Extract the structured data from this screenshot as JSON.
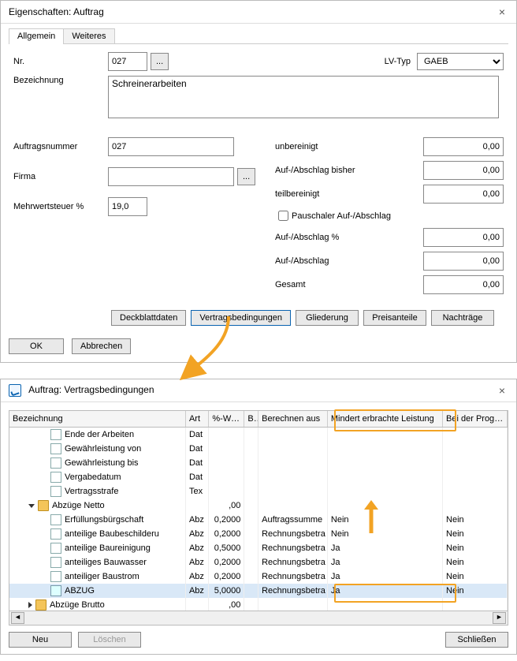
{
  "window1": {
    "title": "Eigenschaften: Auftrag",
    "tabs": {
      "active": "Allgemein",
      "other": "Weiteres"
    },
    "labels": {
      "nr": "Nr.",
      "lvtyp": "LV-Typ",
      "bezeichnung": "Bezeichnung",
      "auftragsnummer": "Auftragsnummer",
      "firma": "Firma",
      "mwst": "Mehrwertsteuer %",
      "unbereinigt": "unbereinigt",
      "aufab_bisher": "Auf-/Abschlag bisher",
      "teilbereinigt": "teilbereinigt",
      "pauschal": "Pauschaler Auf-/Abschlag",
      "aufab_pct": "Auf-/Abschlag %",
      "aufab": "Auf-/Abschlag",
      "gesamt": "Gesamt"
    },
    "values": {
      "nr": "027",
      "lvtyp": "GAEB",
      "bezeichnung": "Schreinerarbeiten",
      "auftragsnummer": "027",
      "firma": "",
      "mwst": "19,0",
      "unbereinigt": "0,00",
      "aufab_bisher": "0,00",
      "teilbereinigt": "0,00",
      "aufab_pct": "0,00",
      "aufab": "0,00",
      "gesamt": "0,00"
    },
    "buttons": {
      "more": "...",
      "deckblatt": "Deckblattdaten",
      "vertrag": "Vertragsbedingungen",
      "gliederung": "Gliederung",
      "preisanteile": "Preisanteile",
      "nachtraege": "Nachträge",
      "ok": "OK",
      "cancel": "Abbrechen"
    }
  },
  "window2": {
    "title": "Auftrag: Vertragsbedingungen",
    "headers": {
      "bez": "Bezeichnung",
      "art": "Art",
      "pct": "%-Wert",
      "br": "Br",
      "berechnen": "Berechnen aus",
      "mindert": "Mindert erbrachte Leistung",
      "prognose": "Bei der Progno"
    },
    "rows": [
      {
        "level": 2,
        "icon": "doc",
        "bez": "Ende der Arbeiten",
        "art": "Dat"
      },
      {
        "level": 2,
        "icon": "doc",
        "bez": "Gewährleistung von",
        "art": "Dat"
      },
      {
        "level": 2,
        "icon": "doc",
        "bez": "Gewährleistung bis",
        "art": "Dat"
      },
      {
        "level": 2,
        "icon": "doc",
        "bez": "Vergabedatum",
        "art": "Dat"
      },
      {
        "level": 2,
        "icon": "doc",
        "bez": "Vertragsstrafe",
        "art": "Tex"
      },
      {
        "level": 1,
        "icon": "folder",
        "tri": "down",
        "bez": "Abzüge Netto",
        "pct": ",00"
      },
      {
        "level": 2,
        "icon": "doc",
        "bez": "Erfüllungsbürgschaft",
        "art": "Abz",
        "pct": "0,2000",
        "ber": "Auftragssumme",
        "min": "Nein",
        "prog": "Nein"
      },
      {
        "level": 2,
        "icon": "doc",
        "bez": "anteilige Baubeschilderu",
        "art": "Abz",
        "pct": "0,2000",
        "ber": "Rechnungsbetra",
        "min": "Nein",
        "prog": "Nein"
      },
      {
        "level": 2,
        "icon": "doc",
        "bez": "anteilige Baureinigung",
        "art": "Abz",
        "pct": "0,5000",
        "ber": "Rechnungsbetra",
        "min": "Ja",
        "prog": "Nein"
      },
      {
        "level": 2,
        "icon": "doc",
        "bez": "anteiliges Bauwasser",
        "art": "Abz",
        "pct": "0,2000",
        "ber": "Rechnungsbetra",
        "min": "Ja",
        "prog": "Nein"
      },
      {
        "level": 2,
        "icon": "doc",
        "bez": "anteiliger Baustrom",
        "art": "Abz",
        "pct": "0,2000",
        "ber": "Rechnungsbetra",
        "min": "Ja",
        "prog": "Nein"
      },
      {
        "level": 2,
        "icon": "doc-sel",
        "bez": "ABZUG",
        "art": "Abz",
        "pct": "5,0000",
        "ber": "Rechnungsbetra",
        "min": "Ja",
        "prog": "Nein",
        "selected": true
      },
      {
        "level": 1,
        "icon": "folder",
        "tri": "right",
        "bez": "Abzüge Brutto",
        "pct": ",00"
      }
    ],
    "buttons": {
      "neu": "Neu",
      "loeschen": "Löschen",
      "schliessen": "Schließen"
    }
  }
}
